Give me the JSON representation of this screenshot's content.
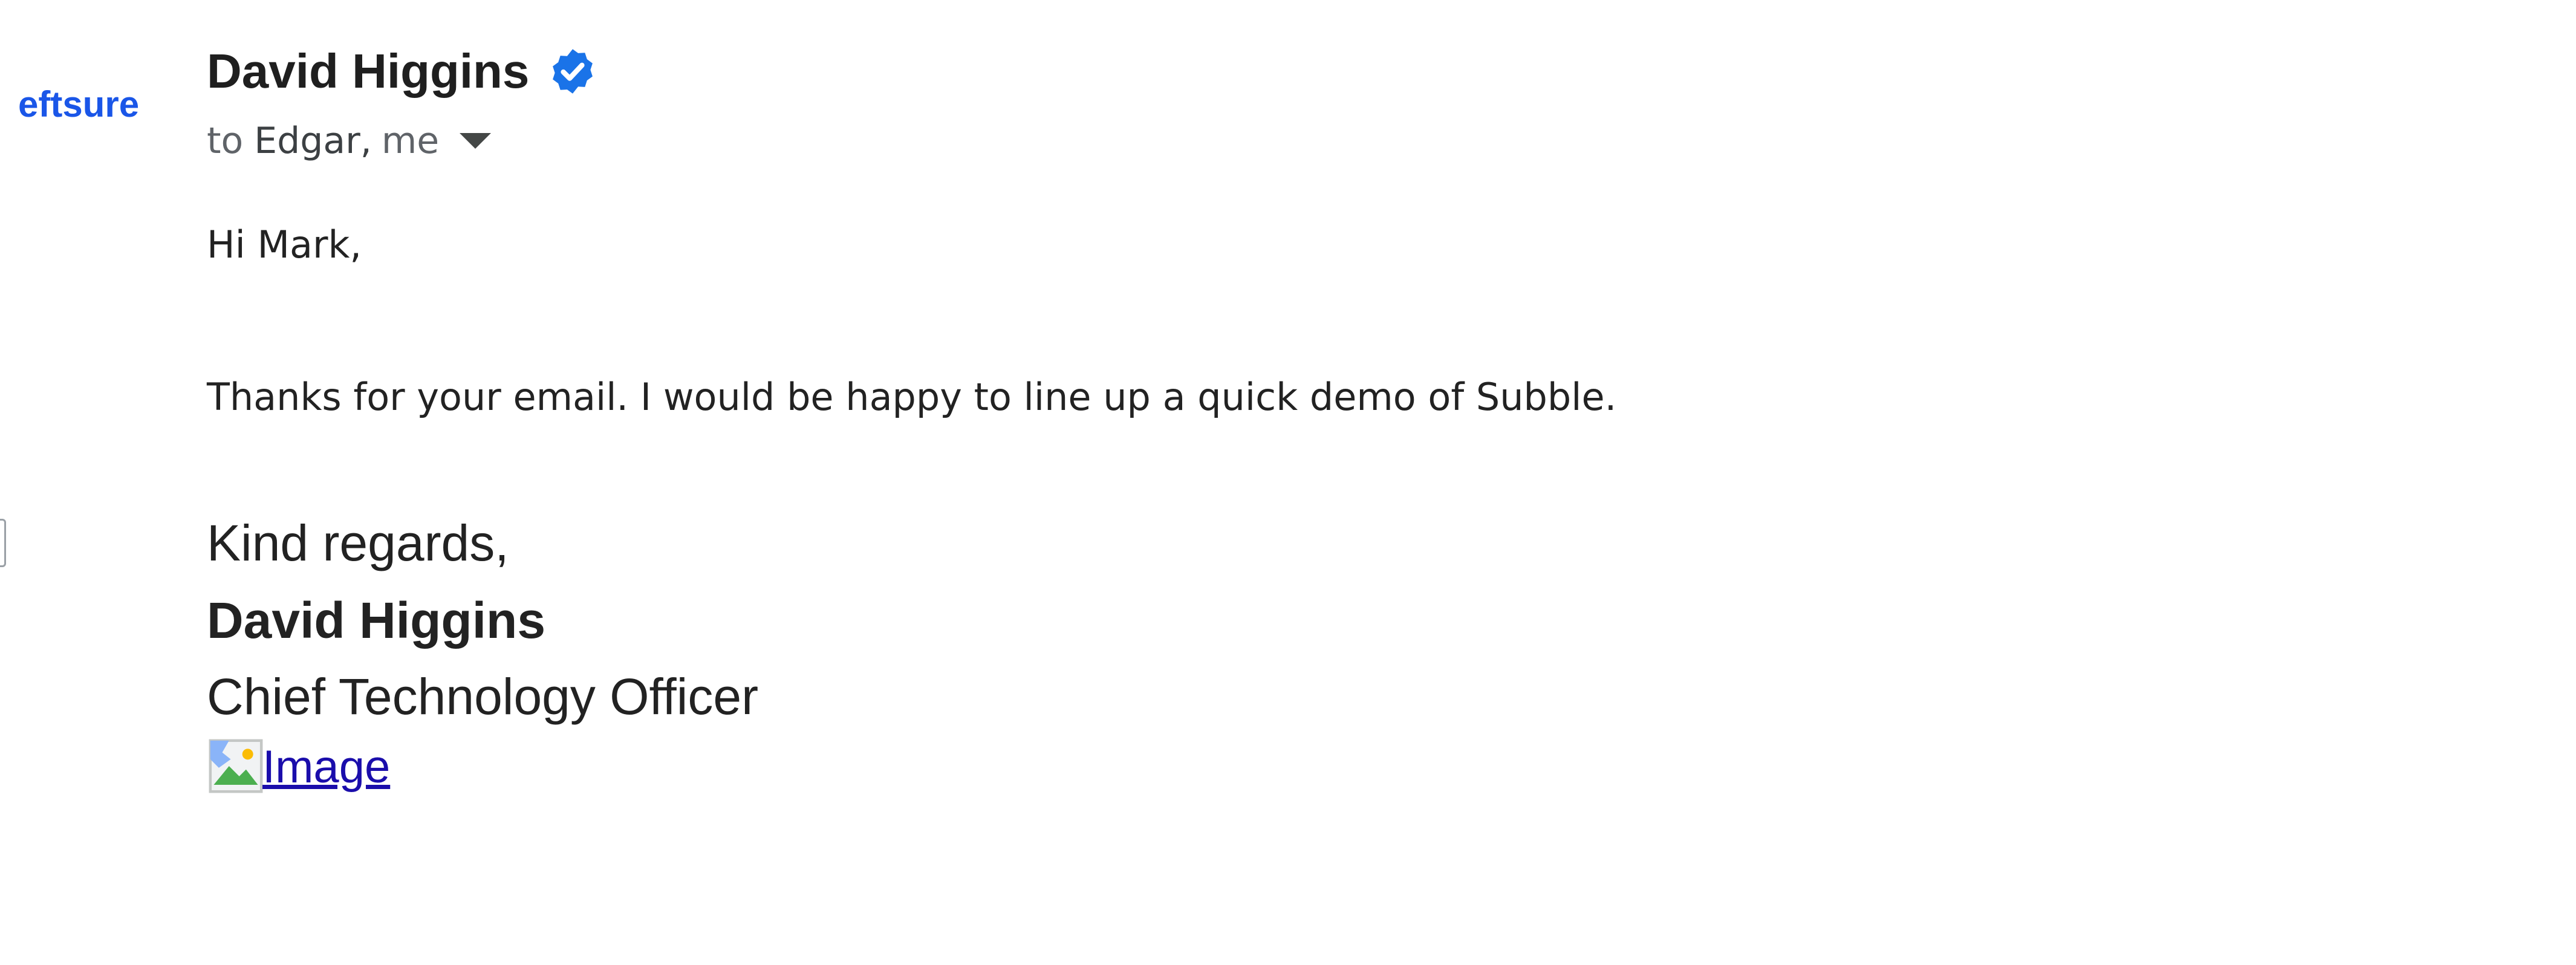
{
  "sender": {
    "logo_text": "eftsure",
    "name": "David Higgins",
    "verified_icon": "verified-badge-icon",
    "accent_color": "#1a73e8"
  },
  "recipients": {
    "to_label": "to",
    "names": "Edgar,",
    "me": "me"
  },
  "body": {
    "greeting": "Hi Mark,",
    "paragraph": "Thanks for your email. I would be happy to line up a quick demo of Subble."
  },
  "signature": {
    "closing": "Kind regards,",
    "name": "David Higgins",
    "title": "Chief Technology Officer",
    "image_alt": "Image"
  }
}
